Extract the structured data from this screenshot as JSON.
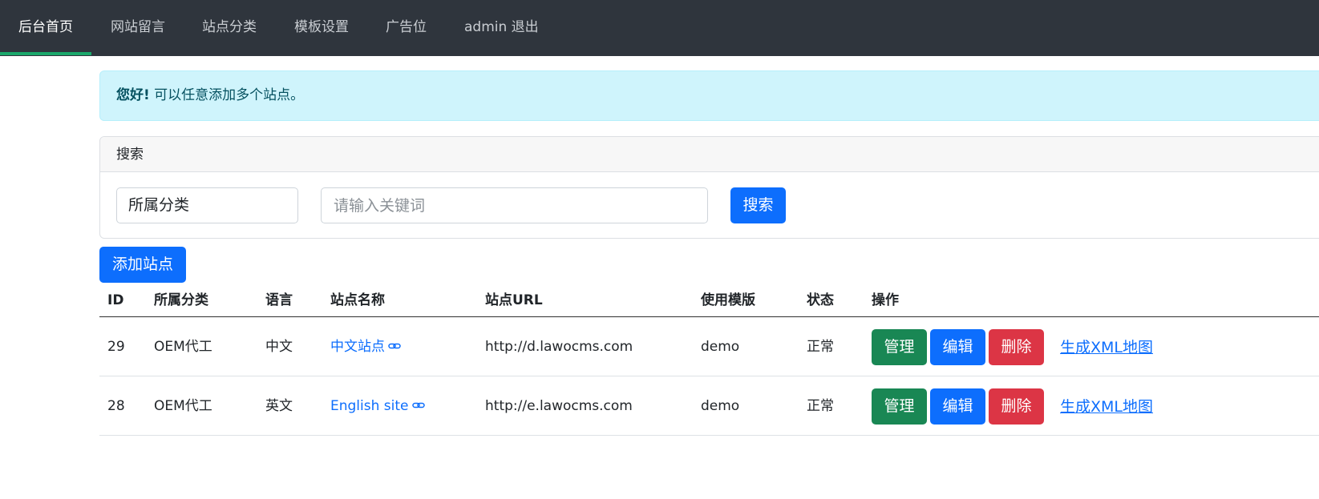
{
  "navbar": {
    "items": [
      {
        "label": "后台首页",
        "active": true
      },
      {
        "label": "网站留言"
      },
      {
        "label": "站点分类"
      },
      {
        "label": "模板设置"
      },
      {
        "label": "广告位"
      },
      {
        "label": "admin 退出"
      }
    ],
    "accent_color": "#1aa86b"
  },
  "alert": {
    "strong": "您好!",
    "text": " 可以任意添加多个站点。"
  },
  "search": {
    "header": "搜索",
    "category_select": "所属分类",
    "keyword_placeholder": "请输入关键词",
    "keyword_value": "",
    "button": "搜索"
  },
  "add_button": "添加站点",
  "table": {
    "headers": [
      "ID",
      "所属分类",
      "语言",
      "站点名称",
      "站点URL",
      "使用模版",
      "状态",
      "操作"
    ],
    "rows": [
      {
        "id": "29",
        "category": "OEM代工",
        "language": "中文",
        "name": "中文站点",
        "url": "http://d.lawocms.com",
        "template": "demo",
        "status": "正常"
      },
      {
        "id": "28",
        "category": "OEM代工",
        "language": "英文",
        "name": "English site",
        "url": "http://e.lawocms.com",
        "template": "demo",
        "status": "正常"
      }
    ],
    "actions": {
      "manage": "管理",
      "edit": "编辑",
      "delete": "删除",
      "xml": "生成XML地图"
    }
  },
  "colors": {
    "primary": "#0d6efd",
    "success": "#198754",
    "danger": "#dc3545",
    "navbar_bg": "#2f353d",
    "alert_bg": "#cff4fc"
  }
}
